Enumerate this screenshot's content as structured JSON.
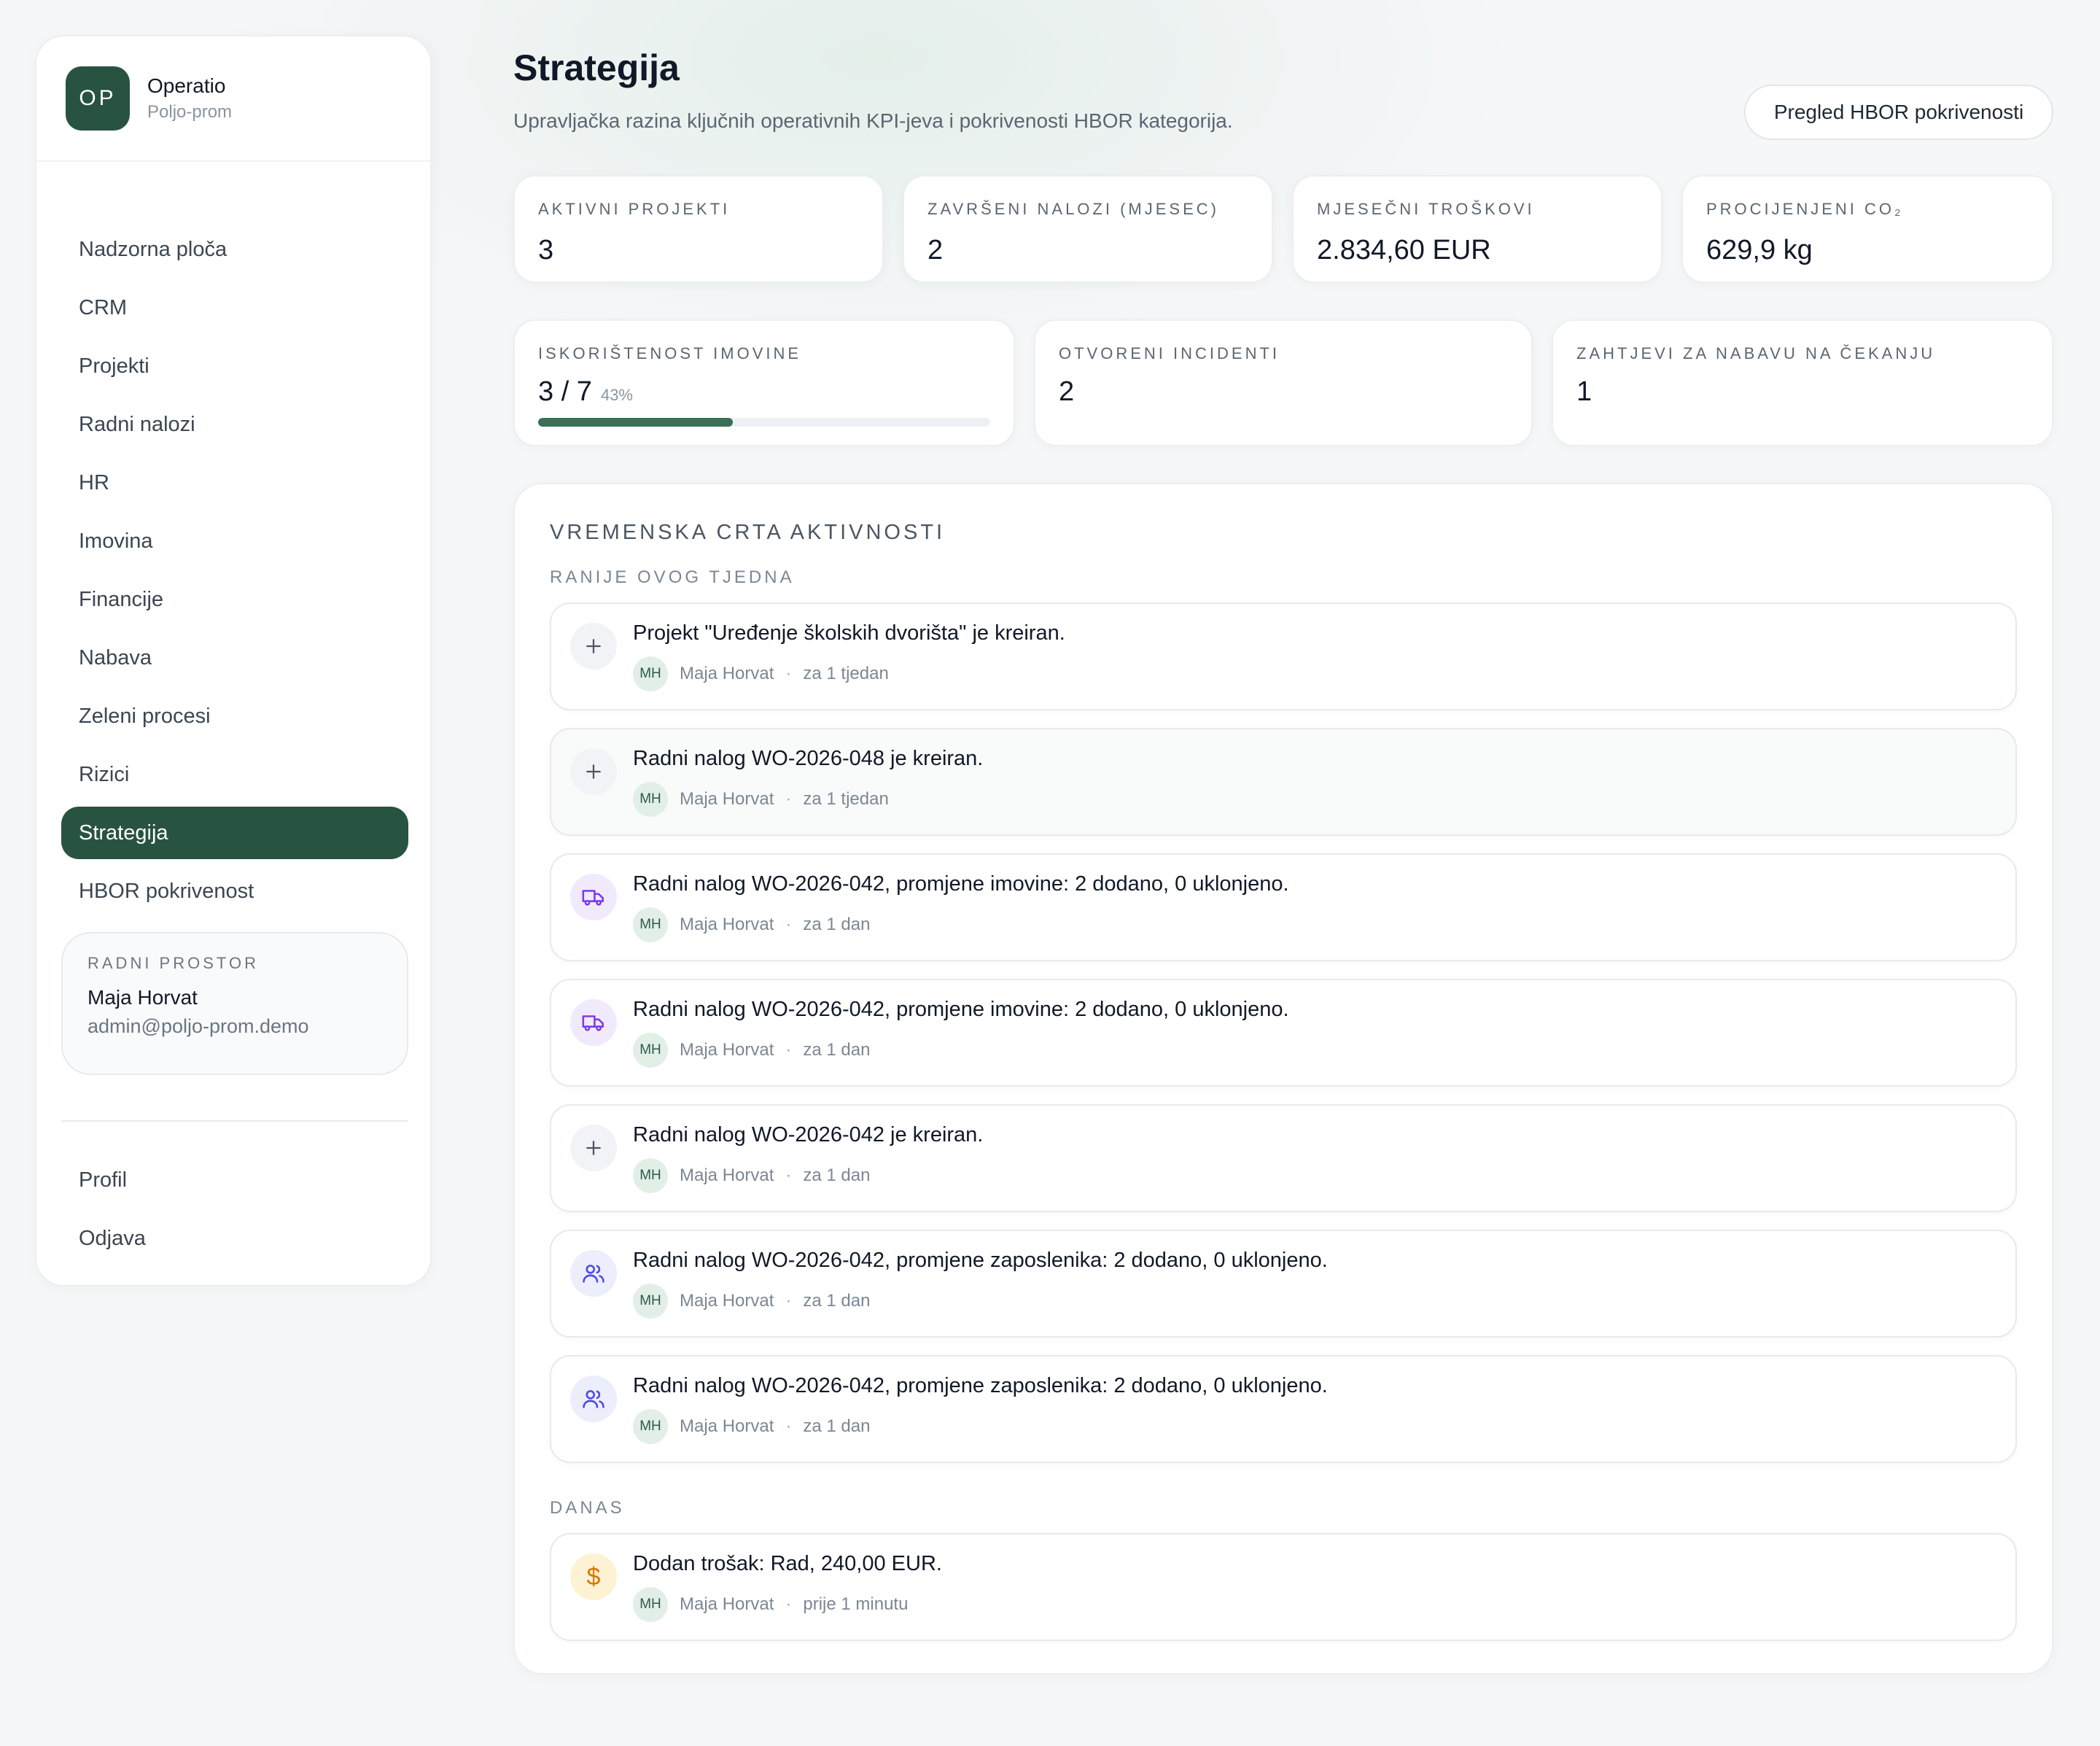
{
  "brand": {
    "initials": "OP",
    "name": "Operatio",
    "subtitle": "Poljo-prom"
  },
  "sidebar": {
    "items": [
      {
        "label": "Nadzorna ploča",
        "active": false
      },
      {
        "label": "CRM",
        "active": false
      },
      {
        "label": "Projekti",
        "active": false
      },
      {
        "label": "Radni nalozi",
        "active": false
      },
      {
        "label": "HR",
        "active": false
      },
      {
        "label": "Imovina",
        "active": false
      },
      {
        "label": "Financije",
        "active": false
      },
      {
        "label": "Nabava",
        "active": false
      },
      {
        "label": "Zeleni procesi",
        "active": false
      },
      {
        "label": "Rizici",
        "active": false
      },
      {
        "label": "Strategija",
        "active": true
      },
      {
        "label": "HBOR pokrivenost",
        "active": false
      }
    ],
    "workspace": {
      "label": "RADNI PROSTOR",
      "name": "Maja Horvat",
      "email": "admin@poljo-prom.demo"
    },
    "bottom_items": [
      {
        "label": "Profil"
      },
      {
        "label": "Odjava"
      }
    ]
  },
  "header": {
    "title": "Strategija",
    "subtitle": "Upravljačka razina ključnih operativnih KPI-jeva i pokrivenosti HBOR kategorija.",
    "button_label": "Pregled HBOR pokrivenosti"
  },
  "kpis_row1": [
    {
      "label": "AKTIVNI PROJEKTI",
      "value": "3"
    },
    {
      "label": "ZAVRŠENI NALOZI (MJESEC)",
      "value": "2"
    },
    {
      "label": "MJESEČNI TROŠKOVI",
      "value": "2.834,60 EUR"
    },
    {
      "label": "PROCIJENJENI CO₂",
      "value": "629,9 kg"
    }
  ],
  "kpis_row2": [
    {
      "label": "ISKORIŠTENOST IMOVINE",
      "value": "3 / 7",
      "percent_label": "43%",
      "progress": 0.43
    },
    {
      "label": "OTVORENI INCIDENTI",
      "value": "2"
    },
    {
      "label": "ZAHTJEVI ZA NABAVU NA ČEKANJU",
      "value": "1"
    }
  ],
  "timeline": {
    "title": "VREMENSKA CRTA AKTIVNOSTI",
    "groups": [
      {
        "label": "RANIJE OVOG TJEDNA",
        "events": [
          {
            "icon": "plus-icon",
            "text": "Projekt \"Uređenje školskih dvorišta\" je kreiran.",
            "initials": "MH",
            "user": "Maja Horvat",
            "time": "za 1 tjedan"
          },
          {
            "icon": "plus-icon",
            "text": "Radni nalog WO-2026-048 je kreiran.",
            "initials": "MH",
            "user": "Maja Horvat",
            "time": "za 1 tjedan"
          },
          {
            "icon": "truck-icon",
            "text": "Radni nalog WO-2026-042, promjene imovine: 2 dodano, 0 uklonjeno.",
            "initials": "MH",
            "user": "Maja Horvat",
            "time": "za 1 dan"
          },
          {
            "icon": "truck-icon",
            "text": "Radni nalog WO-2026-042, promjene imovine: 2 dodano, 0 uklonjeno.",
            "initials": "MH",
            "user": "Maja Horvat",
            "time": "za 1 dan"
          },
          {
            "icon": "plus-icon",
            "text": "Radni nalog WO-2026-042 je kreiran.",
            "initials": "MH",
            "user": "Maja Horvat",
            "time": "za 1 dan"
          },
          {
            "icon": "users-icon",
            "text": "Radni nalog WO-2026-042, promjene zaposlenika: 2 dodano, 0 uklonjeno.",
            "initials": "MH",
            "user": "Maja Horvat",
            "time": "za 1 dan"
          },
          {
            "icon": "users-icon",
            "text": "Radni nalog WO-2026-042, promjene zaposlenika: 2 dodano, 0 uklonjeno.",
            "initials": "MH",
            "user": "Maja Horvat",
            "time": "za 1 dan"
          }
        ]
      },
      {
        "label": "DANAS",
        "events": [
          {
            "icon": "dollar-icon",
            "text": "Dodan trošak: Rad, 240,00 EUR.",
            "initials": "MH",
            "user": "Maja Horvat",
            "time": "prije 1 minutu"
          }
        ]
      }
    ]
  },
  "colors": {
    "accent": "#285340",
    "progress": "#3a6e56",
    "page_bg": "#f6f7f9"
  }
}
